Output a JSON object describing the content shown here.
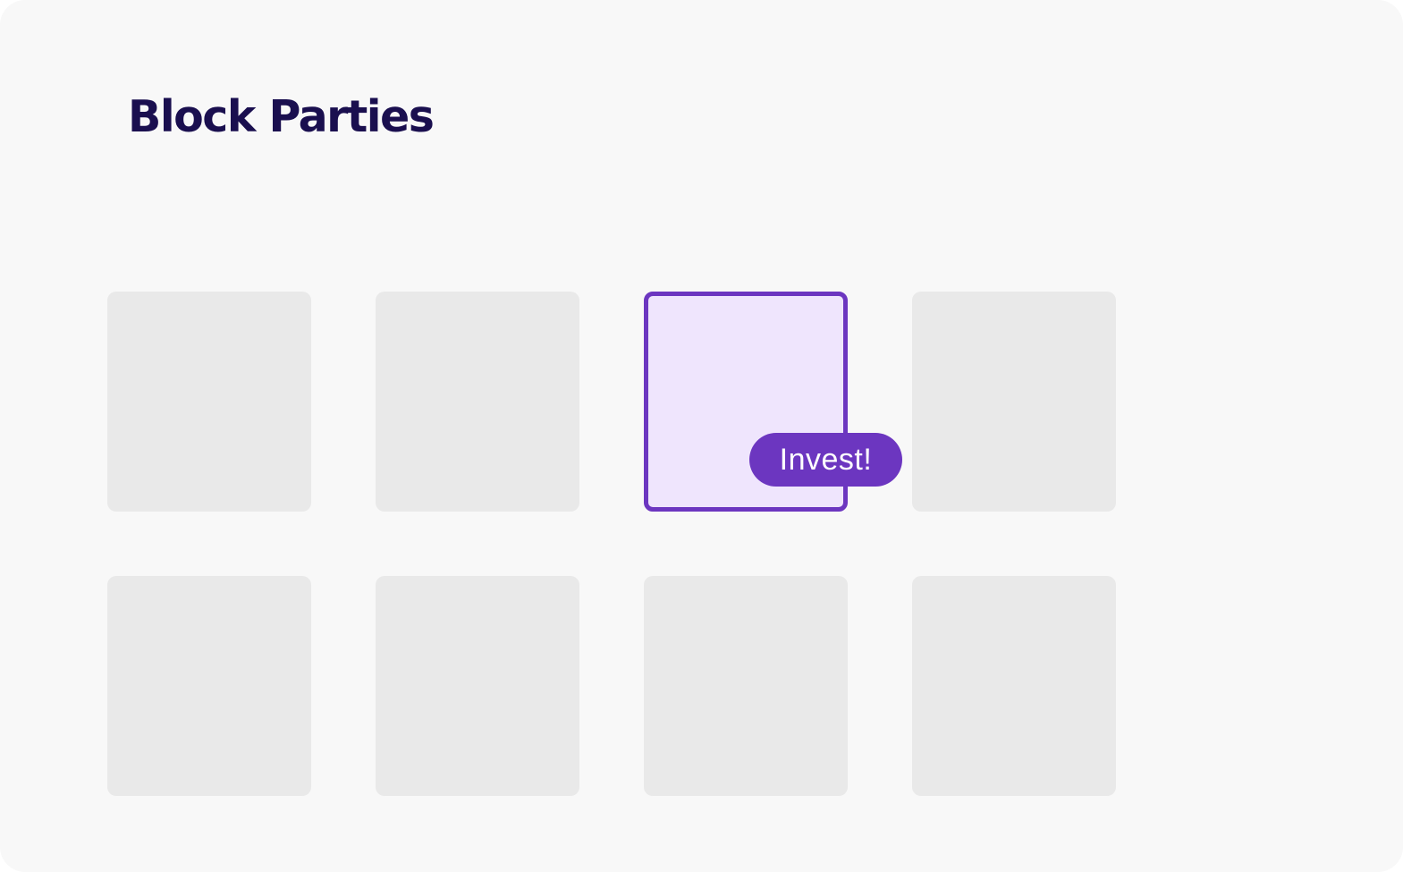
{
  "page": {
    "title": "Block Parties"
  },
  "grid": {
    "selected_index": 2,
    "invest_button_label": "Invest!"
  },
  "colors": {
    "background": "#f8f8f8",
    "title": "#1a0f4f",
    "tile": "#e9e9e9",
    "tile_selected_fill": "#efe5fd",
    "accent": "#6c36c0",
    "button_text": "#ffffff"
  }
}
